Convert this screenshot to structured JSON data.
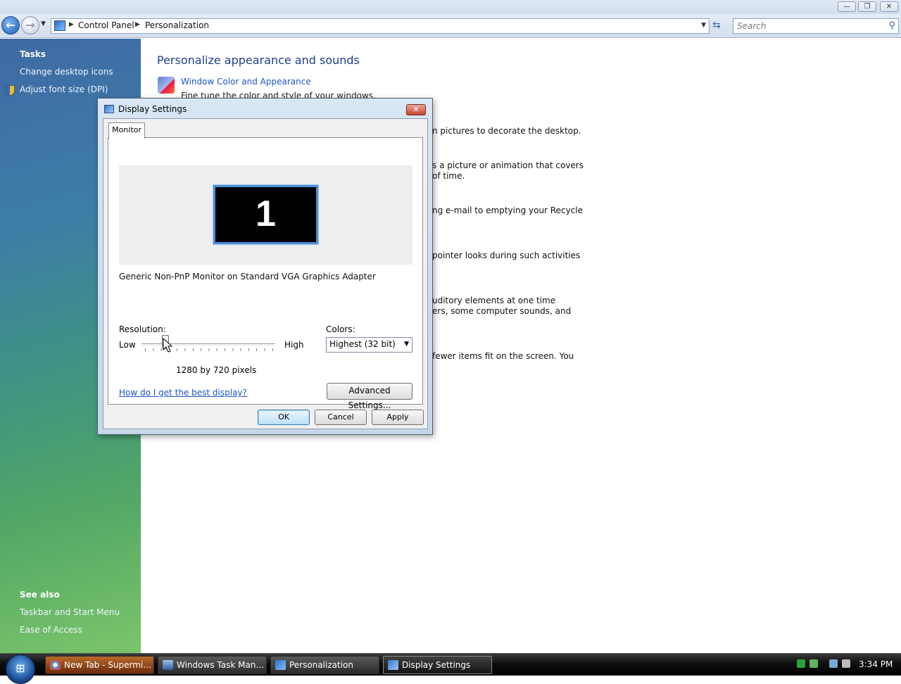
{
  "window": {
    "minimize": "—",
    "maximize": "❐",
    "close": "✕"
  },
  "address": {
    "breadcrumbs": [
      "Control Panel",
      "Personalization"
    ],
    "search_placeholder": "Search"
  },
  "left_pane": {
    "tasks_heading": "Tasks",
    "tasks": [
      "Change desktop icons",
      "Adjust font size (DPI)"
    ],
    "see_also_heading": "See also",
    "see_also": [
      "Taskbar and Start Menu",
      "Ease of Access"
    ]
  },
  "content": {
    "title": "Personalize appearance and sounds",
    "items": [
      {
        "label": "Window Color and Appearance",
        "desc": "Fine tune the color and style of your windows."
      }
    ],
    "partial_lines": [
      "n pictures to decorate the desktop.",
      "s a picture or animation that covers",
      " of time.",
      "ng e-mail to emptying your Recycle",
      " pointer looks during such activities",
      "uditory elements at one time",
      "ers, some computer sounds, and",
      "fewer items fit on the screen. You"
    ]
  },
  "dialog": {
    "title": "Display Settings",
    "close_glyph": "✕",
    "tab": "Monitor",
    "monitor_number": "1",
    "monitor_name": "Generic Non-PnP Monitor on Standard VGA Graphics Adapter",
    "resolution_label": "Resolution:",
    "low_label": "Low",
    "high_label": "High",
    "resolution_value": "1280 by 720 pixels",
    "colors_label": "Colors:",
    "colors_selected": "Highest (32 bit)",
    "help_link": "How do I get the best display?",
    "advanced_button": "Advanced Settings...",
    "ok_button": "OK",
    "cancel_button": "Cancel",
    "apply_button": "Apply"
  },
  "taskbar": {
    "tasks": [
      "New Tab - Supermi...",
      "Windows Task Man...",
      "Personalization",
      "Display Settings"
    ],
    "active_task": "Display Settings",
    "clock": "3:34 PM"
  }
}
